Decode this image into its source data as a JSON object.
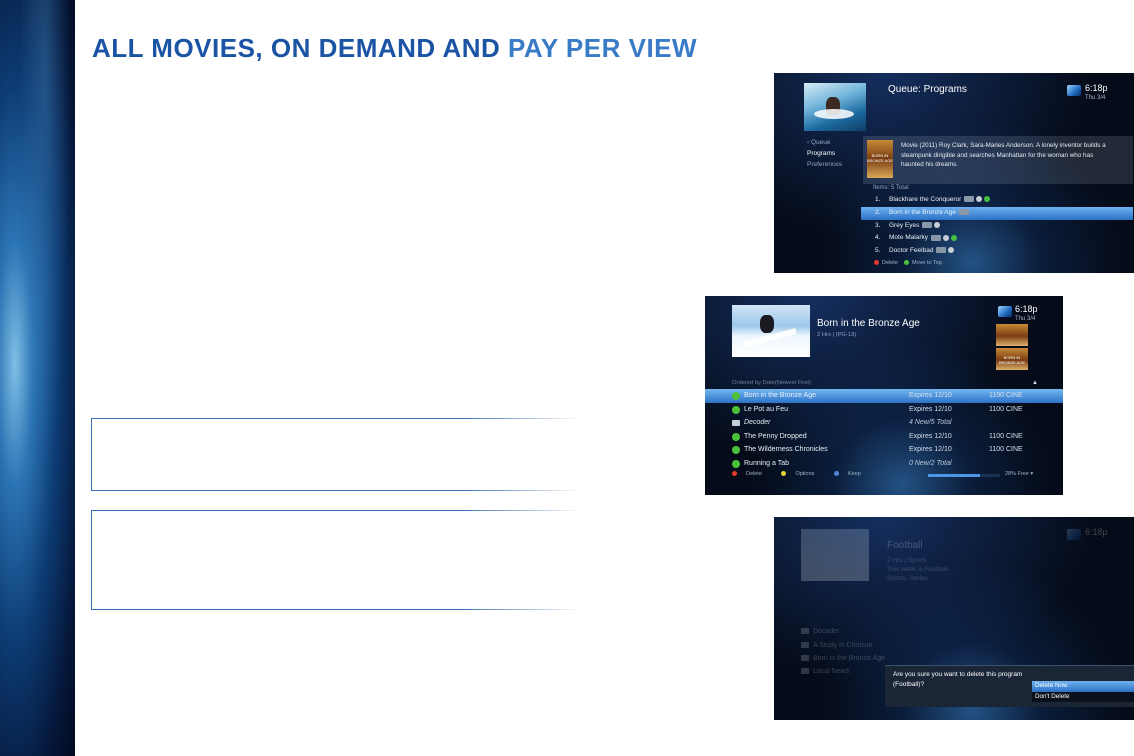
{
  "page": {
    "title_part1": "ALL MOVIES, ON DEMAND AND ",
    "title_part2": "PAY PER VIEW"
  },
  "colors": {
    "title_blue": "#1b54a5",
    "title_blue_light": "#3a7bc8",
    "highlight_blue": "#2a72c6",
    "screen_bg": "#050b18",
    "red_button": "#e53a2e",
    "green_button": "#4cc23a",
    "yellow_button": "#e8d531",
    "blue_button": "#4e86d8"
  },
  "screen1": {
    "title": "Queue: Programs",
    "time": "6:18p",
    "date": "Thu 3/4",
    "nav": [
      "‹ Queue",
      "Programs",
      "Preferences"
    ],
    "description": "Movie (2011) Roy Clark, Sara-Maries Anderson. A lonely inventor builds a steampunk dirigible and searches Manhattan for the woman who has haunted his dreams.",
    "poster_text": "BORN IN BRONZE AGE",
    "items_count": "Items: 5 Total",
    "items": [
      {
        "num": "1.",
        "name": "Blackhare the Conqueror"
      },
      {
        "num": "2.",
        "name": "Born in the Bronze Age"
      },
      {
        "num": "3.",
        "name": "Grey Eyes"
      },
      {
        "num": "4.",
        "name": "Mote Malarky"
      },
      {
        "num": "5.",
        "name": "Doctor Feelbad"
      }
    ],
    "footer_delete": "Delete",
    "footer_move": "Move to Top"
  },
  "screen2": {
    "title": "Born in the Bronze Age",
    "meta": "2 Hrs | (PG-13)",
    "time": "6:18p",
    "date": "Thu 3/4",
    "poster_text": "BORN IN BRONZE AGE",
    "order_label": "Ordered by Date(Newest First)",
    "rows": [
      {
        "name": "Born in the Bronze Age",
        "expires": "Expires 12/10",
        "channel": "1100 CINE",
        "type": "program"
      },
      {
        "name": "Le Pot au Feu",
        "expires": "Expires 12/10",
        "channel": "1100 CINE",
        "type": "program"
      },
      {
        "name": "Decoder",
        "expires": "4 New/5 Total",
        "channel": "",
        "type": "folder"
      },
      {
        "name": "The Penny Dropped",
        "expires": "Expires 12/10",
        "channel": "1100 CINE",
        "type": "program"
      },
      {
        "name": "The Wilderness Chronicles",
        "expires": "Expires 12/10",
        "channel": "1100 CINE",
        "type": "program"
      },
      {
        "name": "Running a Tab",
        "expires": "0 New/2 Total",
        "channel": "",
        "type": "program"
      }
    ],
    "footer_delete": "Delete",
    "footer_options": "Options",
    "footer_keep": "Keep",
    "free_space": "28% Free",
    "free_fraction": 0.72
  },
  "screen3": {
    "title": "Football",
    "time": "6:18p",
    "bg_lines": [
      "2 Hrs | Sports",
      "This week in Football",
      "Sports, Series"
    ],
    "rows": [
      "Decoder",
      "A Study in Crimson",
      "Born in the Bronze Age",
      "Local News"
    ],
    "dialog_message": "Are you sure you want to delete this program (Football)?",
    "option_delete": "Delete Now",
    "option_keep": "Don't Delete"
  }
}
